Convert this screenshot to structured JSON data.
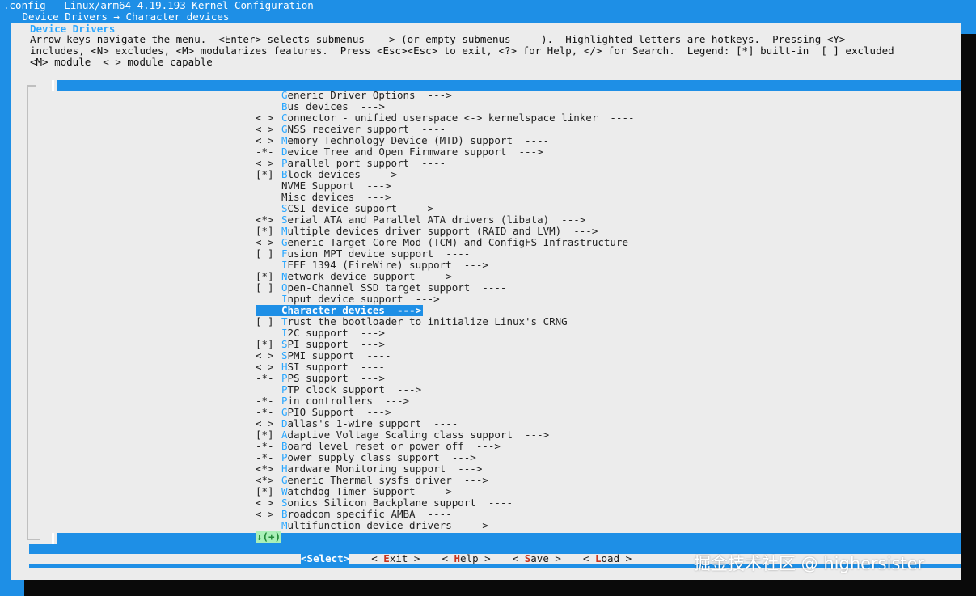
{
  "header": {
    "title": ".config - Linux/arm64 4.19.193 Kernel Configuration",
    "breadcrumb": " Device Drivers → Character devices"
  },
  "dialog": {
    "title": "Device Drivers",
    "help_lines": [
      "Arrow keys navigate the menu.  <Enter> selects submenus ---> (or empty submenus ----).  Highlighted letters are hotkeys.  Pressing <Y>",
      "includes, <N> excludes, <M> modularizes features.  Press <Esc><Esc> to exit, <?> for Help, </> for Search.  Legend: [*] built-in  [ ] excluded",
      "<M> module  < > module capable"
    ]
  },
  "menu": {
    "items": [
      {
        "prefix": "    ",
        "hotkey": "G",
        "rest": "eneric Driver Options  --->"
      },
      {
        "prefix": "    ",
        "hotkey": "B",
        "rest": "us devices  --->"
      },
      {
        "prefix": "< > ",
        "hotkey": "C",
        "rest": "onnector - unified userspace <-> kernelspace linker  ----"
      },
      {
        "prefix": "< > ",
        "hotkey": "G",
        "rest": "NSS receiver support  ----"
      },
      {
        "prefix": "< > ",
        "hotkey": "M",
        "rest": "emory Technology Device (MTD) support  ----"
      },
      {
        "prefix": "-*- ",
        "hotkey": "D",
        "rest": "evice Tree and Open Firmware support  --->"
      },
      {
        "prefix": "< > ",
        "hotkey": "P",
        "rest": "arallel port support  ----"
      },
      {
        "prefix": "[*] ",
        "hotkey": "B",
        "rest": "lock devices  --->"
      },
      {
        "prefix": "    ",
        "hotkey": "N",
        "rest": "VME Support  --->",
        "hotkey_index": 1
      },
      {
        "prefix": "    ",
        "hotkey": "M",
        "rest": "isc devices  --->",
        "hotkey_index": 1
      },
      {
        "prefix": "    ",
        "hotkey": "S",
        "rest": "CSI device support  --->"
      },
      {
        "prefix": "<*> ",
        "hotkey": "S",
        "rest": "erial ATA and Parallel ATA drivers (libata)  --->"
      },
      {
        "prefix": "[*] ",
        "hotkey": "M",
        "rest": "ultiple devices driver support (RAID and LVM)  --->"
      },
      {
        "prefix": "< > ",
        "hotkey": "G",
        "rest": "eneric Target Core Mod (TCM) and ConfigFS Infrastructure  ----"
      },
      {
        "prefix": "[ ] ",
        "hotkey": "F",
        "rest": "usion MPT device support  ----"
      },
      {
        "prefix": "    ",
        "hotkey": "I",
        "rest": "EEE 1394 (FireWire) support  --->"
      },
      {
        "prefix": "[*] ",
        "hotkey": "N",
        "rest": "etwork device support  --->"
      },
      {
        "prefix": "[ ] ",
        "hotkey": "O",
        "rest": "pen-Channel SSD target support  ----"
      },
      {
        "prefix": "    ",
        "hotkey": "I",
        "rest": "nput device support  --->"
      },
      {
        "prefix": "    ",
        "hotkey": "C",
        "rest": "haracter devices  --->",
        "selected": true
      },
      {
        "prefix": "[ ] ",
        "hotkey": "T",
        "rest": "rust the bootloader to initialize Linux's CRNG"
      },
      {
        "prefix": "    ",
        "hotkey": "I",
        "rest": "2C support  --->"
      },
      {
        "prefix": "[*] ",
        "hotkey": "S",
        "rest": "PI support  --->"
      },
      {
        "prefix": "< > ",
        "hotkey": "S",
        "rest": "PMI support  ----"
      },
      {
        "prefix": "< > ",
        "hotkey": "H",
        "rest": "SI support  ----"
      },
      {
        "prefix": "-*- ",
        "hotkey": "P",
        "rest": "PS support  --->"
      },
      {
        "prefix": "    ",
        "hotkey": "P",
        "rest": "TP clock support  --->"
      },
      {
        "prefix": "-*- ",
        "hotkey": "P",
        "rest": "in controllers  --->"
      },
      {
        "prefix": "-*- ",
        "hotkey": "G",
        "rest": "PIO Support  --->"
      },
      {
        "prefix": "< > ",
        "hotkey": "D",
        "rest": "allas's 1-wire support  ----"
      },
      {
        "prefix": "[*] ",
        "hotkey": "A",
        "rest": "daptive Voltage Scaling class support  --->"
      },
      {
        "prefix": "-*- ",
        "hotkey": "B",
        "rest": "oard level reset or power off  --->"
      },
      {
        "prefix": "-*- ",
        "hotkey": "P",
        "rest": "ower supply class support  --->"
      },
      {
        "prefix": "<*> ",
        "hotkey": "H",
        "rest": "ardware Monitoring support  --->"
      },
      {
        "prefix": "<*> ",
        "hotkey": "G",
        "rest": "eneric Thermal sysfs driver  --->"
      },
      {
        "prefix": "[*] ",
        "hotkey": "W",
        "rest": "atchdog Timer Support  --->"
      },
      {
        "prefix": "< > ",
        "hotkey": "S",
        "rest": "onics Silicon Backplane support  ----"
      },
      {
        "prefix": "< > ",
        "hotkey": "B",
        "rest": "roadcom specific AMBA  ----"
      },
      {
        "prefix": "    ",
        "hotkey": "M",
        "rest": "ultifunction device drivers  --->"
      }
    ],
    "more_indicator": "↓(+)"
  },
  "buttons": [
    {
      "pre": "<",
      "hot": "S",
      "post": "elect>",
      "active": true
    },
    {
      "pre": "< ",
      "hot": "E",
      "post": "xit >",
      "active": false
    },
    {
      "pre": "< ",
      "hot": "H",
      "post": "elp >",
      "active": false
    },
    {
      "pre": "< ",
      "hot": "S",
      "post": "ave >",
      "active": false
    },
    {
      "pre": "< ",
      "hot": "L",
      "post": "oad >",
      "active": false
    }
  ],
  "watermark": "掘金技术社区 @ highersister",
  "colors": {
    "background": "#1e8fe6",
    "dialog": "#ececec",
    "hotkey": "#2aa7ff",
    "button_hotkey": "#c8341f",
    "more_indicator_bg": "#aaf0b8"
  }
}
